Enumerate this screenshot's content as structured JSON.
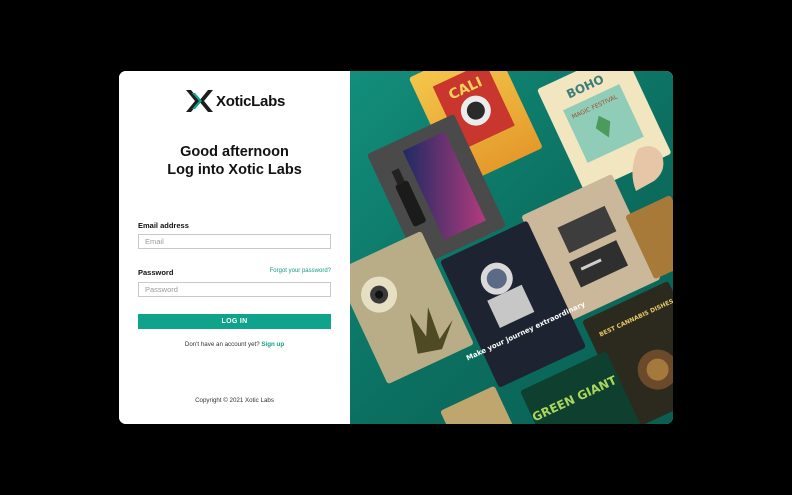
{
  "brand": {
    "name": "XoticLabs",
    "accent": "#10a38b",
    "logo_dark": "#1d1d1d"
  },
  "greeting": {
    "line1": "Good afternoon",
    "line2": "Log into Xotic Labs"
  },
  "form": {
    "email_label": "Email address",
    "email_placeholder": "Email",
    "password_label": "Password",
    "password_placeholder": "Password",
    "forgot_link": "Forgot your password?",
    "login_button": "LOG IN"
  },
  "signup": {
    "prompt": "Don't have an account yet?",
    "link": "Sign up"
  },
  "footer": {
    "copyright": "Copyright © 2021 Xotic Labs"
  },
  "showcase": {
    "tiles": [
      {
        "name": "cali-bag-tile",
        "bg": "#d9b23a"
      },
      {
        "name": "boho-bag-tile",
        "bg": "#f1e6bf"
      },
      {
        "name": "tincture-box-tile",
        "bg": "#2d2c52"
      },
      {
        "name": "business-card-tile",
        "bg": "#cbb89a"
      },
      {
        "name": "eye-poster-tile",
        "bg": "#b8ad86"
      },
      {
        "name": "astronaut-poster-tile",
        "bg": "#1d2330"
      },
      {
        "name": "news-poster-tile",
        "bg": "#2c2a1e"
      },
      {
        "name": "green-giant-tile",
        "bg": "#0f3f2e"
      },
      {
        "name": "small-tile",
        "bg": "#7a5431"
      }
    ],
    "texts": {
      "cali": "CALI",
      "boho": "BOHO",
      "boho_sub": "MAGIC FESTIVAL",
      "astro": "Make your journey extraordinary",
      "news": "BEST CANNABIS DISHES IN TOWN",
      "giant": "GREEN GIANT"
    }
  }
}
